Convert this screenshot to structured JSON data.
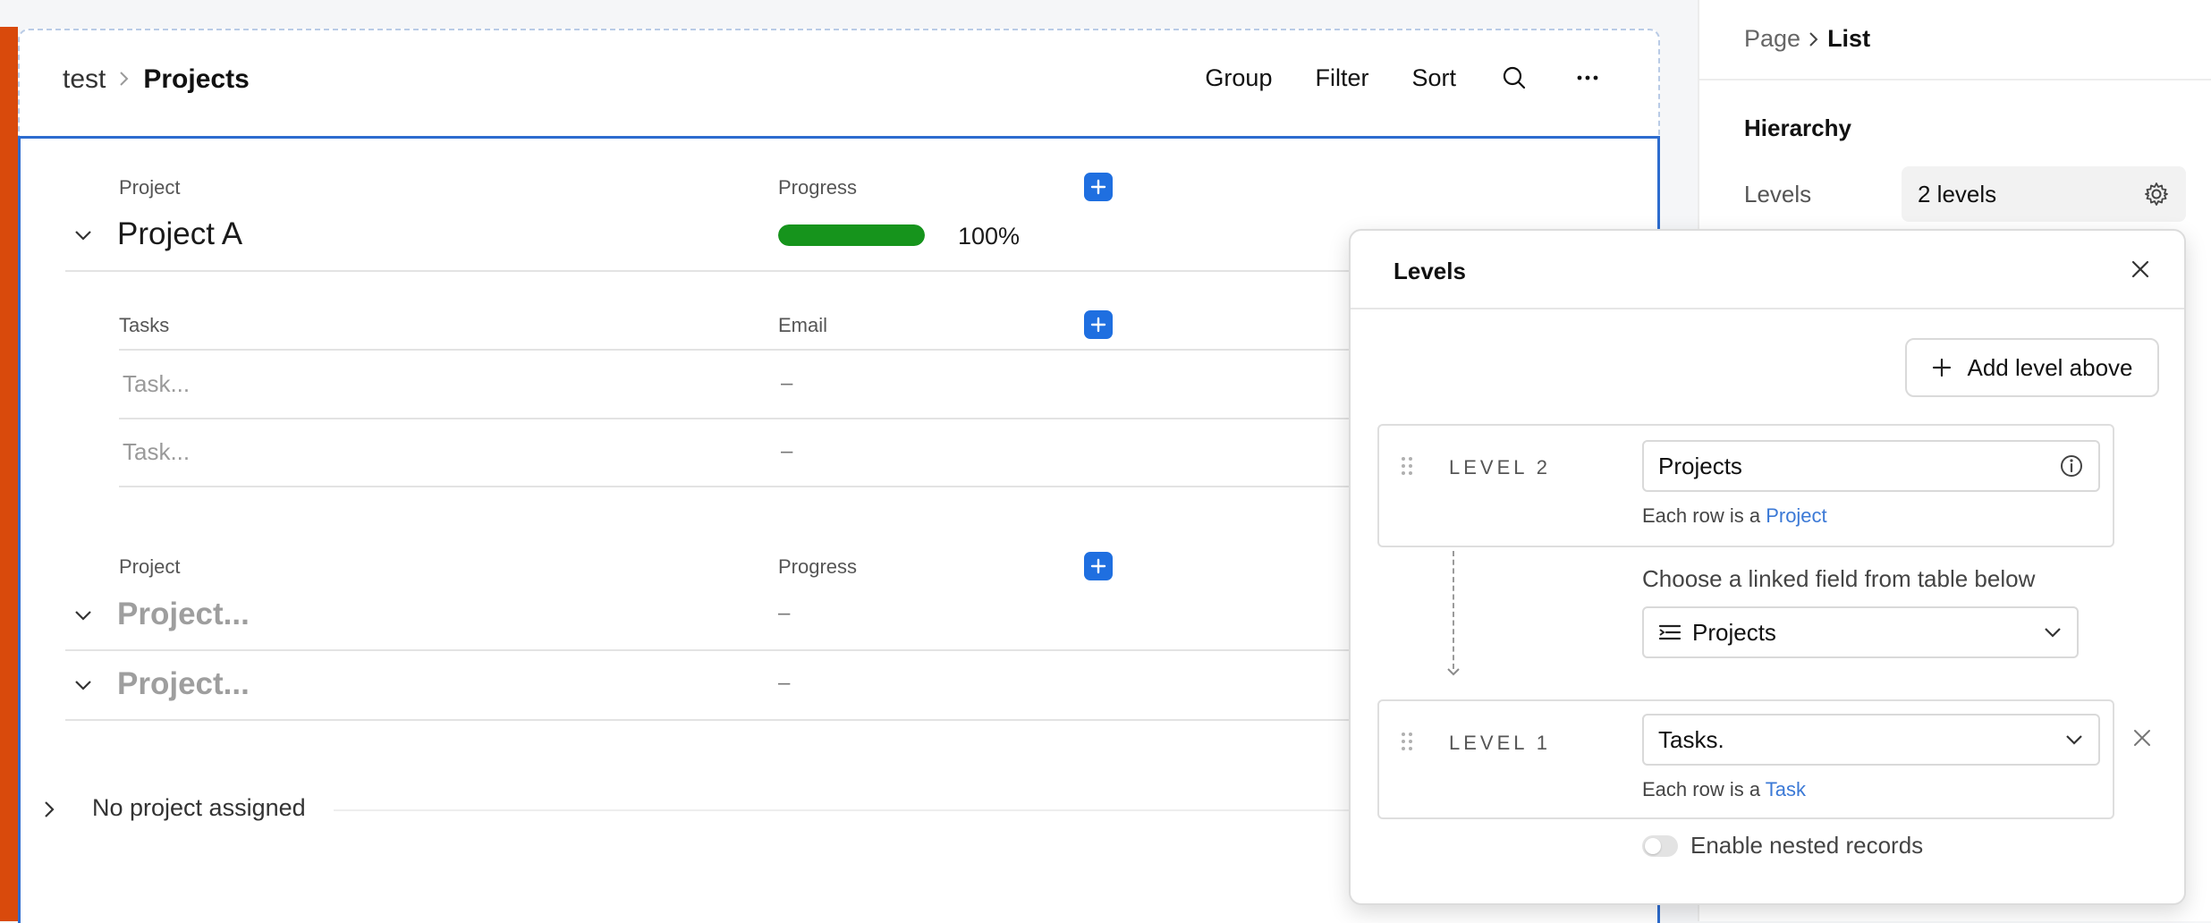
{
  "breadcrumb": {
    "parent": "test",
    "current": "Projects"
  },
  "toolbar": {
    "group": "Group",
    "filter": "Filter",
    "sort": "Sort"
  },
  "list": {
    "group_a": {
      "col_project": "Project",
      "col_progress": "Progress",
      "title": "Project A",
      "progress_value": 1.0,
      "progress_text": "100%"
    },
    "tasks": {
      "col_tasks": "Tasks",
      "col_email": "Email",
      "rows": [
        {
          "task": "Task...",
          "email": "–"
        },
        {
          "task": "Task...",
          "email": "–"
        }
      ]
    },
    "group_b": {
      "col_project": "Project",
      "col_progress": "Progress",
      "rows": [
        {
          "title": "Project...",
          "progress": "–"
        },
        {
          "title": "Project...",
          "progress": "–"
        }
      ]
    },
    "no_project": "No project assigned"
  },
  "right_panel": {
    "crumb_page": "Page",
    "crumb_current": "List",
    "hierarchy_title": "Hierarchy",
    "levels_label": "Levels",
    "levels_value": "2 levels"
  },
  "levels_popover": {
    "title": "Levels",
    "add_level_label": "Add level above",
    "level2": {
      "label": "LEVEL 2",
      "value": "Projects",
      "each_row_prefix": "Each row is a",
      "each_row_link": "Project"
    },
    "choose_label": "Choose a linked field from table below",
    "linked_field": "Projects",
    "level1": {
      "label": "LEVEL 1",
      "value": "Tasks.",
      "each_row_prefix": "Each row is a",
      "each_row_link": "Task"
    },
    "nested_label": "Enable nested records",
    "nested_enabled": false
  },
  "colors": {
    "accent_strip": "#d94a0c",
    "selection_border": "#2d6ccf",
    "add_button": "#1f6fe0",
    "progress": "#16941c",
    "link": "#3b79d6"
  },
  "icons": [
    "chevron-right-icon",
    "search-icon",
    "more-icon",
    "plus-icon",
    "chevron-down-icon",
    "gear-icon",
    "close-icon",
    "drag-handle-icon",
    "info-icon",
    "lines-icon",
    "arrow-down-icon"
  ]
}
